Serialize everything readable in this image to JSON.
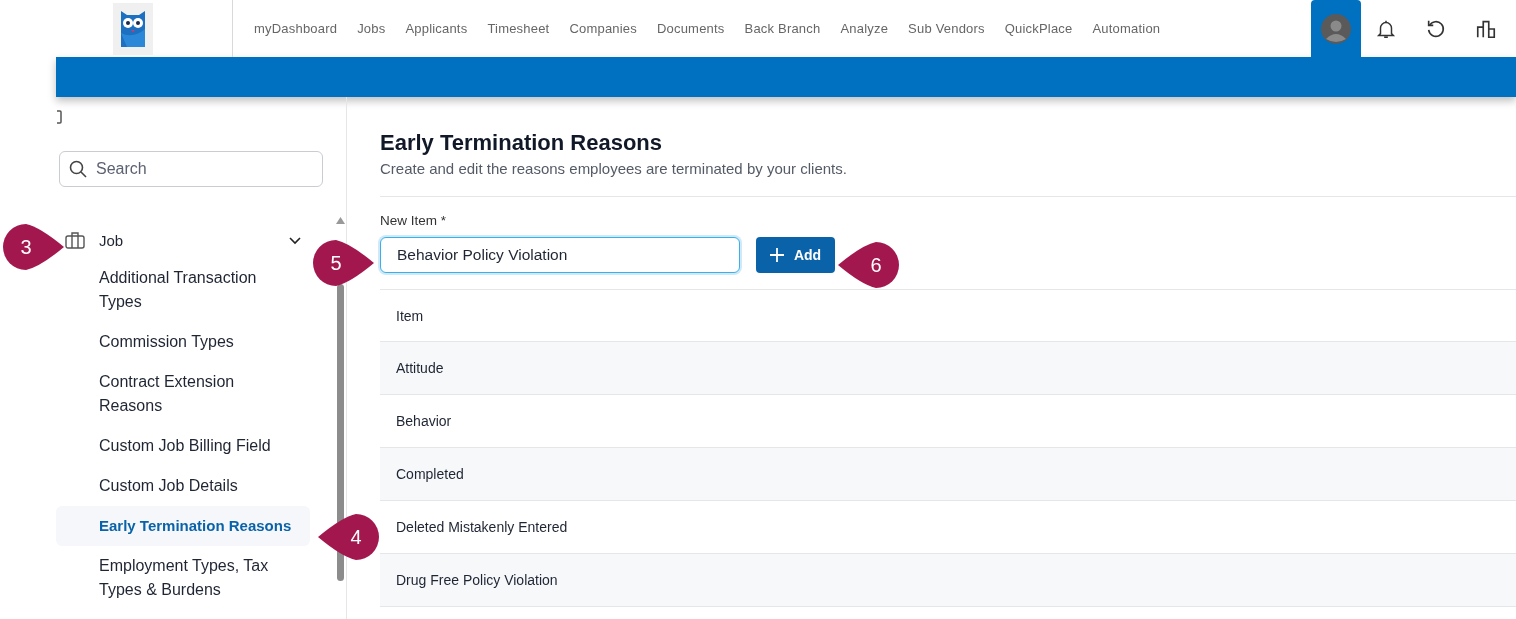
{
  "nav": {
    "items": [
      {
        "label": "myDashboard"
      },
      {
        "label": "Jobs"
      },
      {
        "label": "Applicants"
      },
      {
        "label": "Timesheet"
      },
      {
        "label": "Companies"
      },
      {
        "label": "Documents"
      },
      {
        "label": "Back Branch"
      },
      {
        "label": "Analyze"
      },
      {
        "label": "Sub Vendors"
      },
      {
        "label": "QuickPlace"
      },
      {
        "label": "Automation"
      }
    ]
  },
  "sidebar": {
    "search": {
      "placeholder": "Search"
    },
    "group": {
      "label": "Job",
      "expanded": true,
      "children": [
        {
          "label": "Additional Transaction Types",
          "selected": false
        },
        {
          "label": "Commission Types",
          "selected": false
        },
        {
          "label": "Contract Extension Reasons",
          "selected": false
        },
        {
          "label": "Custom Job Billing Field",
          "selected": false
        },
        {
          "label": "Custom Job Details",
          "selected": false
        },
        {
          "label": "Early Termination Reasons",
          "selected": true
        },
        {
          "label": "Employment Types, Tax Types & Burdens",
          "selected": false
        }
      ]
    }
  },
  "page": {
    "title": "Early Termination Reasons",
    "subtitle": "Create and edit the reasons employees are terminated by your clients.",
    "new_item": {
      "label": "New Item *",
      "value": "Behavior Policy Violation"
    },
    "add_button": {
      "label": "Add"
    }
  },
  "table": {
    "columns": [
      "Item"
    ],
    "rows": [
      {
        "item": "Attitude"
      },
      {
        "item": "Behavior"
      },
      {
        "item": "Completed"
      },
      {
        "item": "Deleted Mistakenly Entered"
      },
      {
        "item": "Drug Free Policy Violation"
      }
    ]
  },
  "callouts": [
    {
      "number": "3"
    },
    {
      "number": "4"
    },
    {
      "number": "5"
    },
    {
      "number": "6"
    }
  ]
}
